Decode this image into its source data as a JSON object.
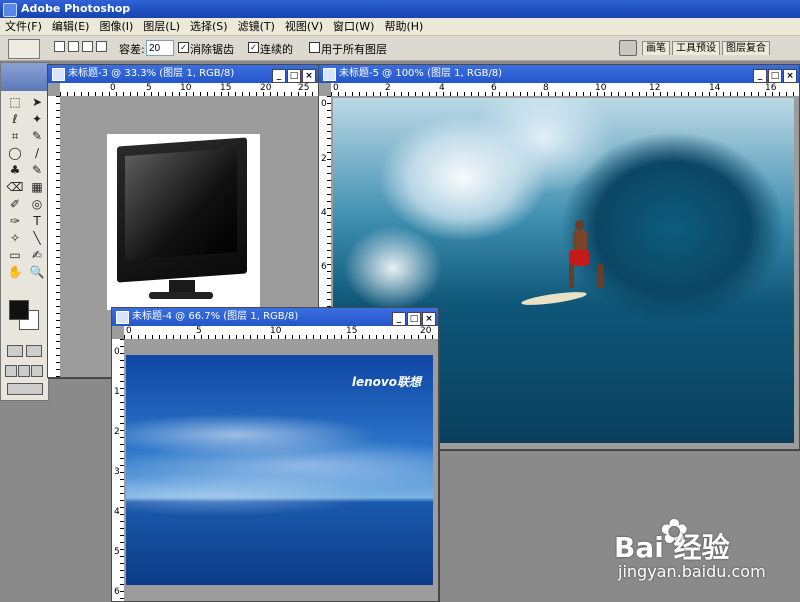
{
  "app": {
    "title": "Adobe Photoshop"
  },
  "menu": [
    "文件(F)",
    "编辑(E)",
    "图像(I)",
    "图层(L)",
    "选择(S)",
    "滤镜(T)",
    "视图(V)",
    "窗口(W)",
    "帮助(H)"
  ],
  "options": {
    "tolerance_label": "容差:",
    "tolerance_value": "20",
    "antialias_label": "消除锯齿",
    "antialias_checked": "✓",
    "contiguous_label": "连续的",
    "contiguous_checked": "✓",
    "all_layers_label": "用于所有图层"
  },
  "palette_well": [
    "画笔",
    "工具预设",
    "图层复合"
  ],
  "toolbox": {
    "tools": [
      "⬚",
      "➤",
      "ℓ",
      "✦",
      "⌗",
      "✎",
      "◯",
      "∕",
      "♣",
      "✎",
      "⌫",
      "▦",
      "✐",
      "◎",
      "✑",
      "T",
      "✧",
      "╲",
      "▭",
      "✍",
      "✋",
      "🔍"
    ]
  },
  "windows": {
    "doc3": {
      "title": "未标题-3 @ 33.3% (图层 1, RGB/8)",
      "hruler": [
        "0",
        "5",
        "10",
        "15",
        "20",
        "25"
      ]
    },
    "doc5": {
      "title": "未标题-5 @ 100% (图层 1, RGB/8)",
      "hruler": [
        "0",
        "2",
        "4",
        "6",
        "8",
        "10",
        "12",
        "14",
        "16"
      ],
      "vruler": [
        "0",
        "2",
        "4",
        "6",
        "8"
      ]
    },
    "doc4": {
      "title": "未标题-4 @ 66.7% (图层 1, RGB/8)",
      "hruler": [
        "0",
        "5",
        "10",
        "15",
        "20"
      ],
      "vruler": [
        "0",
        "1",
        "2",
        "3",
        "4",
        "5",
        "6"
      ]
    }
  },
  "lenovo": {
    "logo": "lenovo联想"
  },
  "watermark": {
    "brand": "Bai 经验",
    "url": "jingyan.baidu.com"
  },
  "colors": {
    "titlebar": "#2556c9",
    "workspace": "#8a8a8a"
  }
}
